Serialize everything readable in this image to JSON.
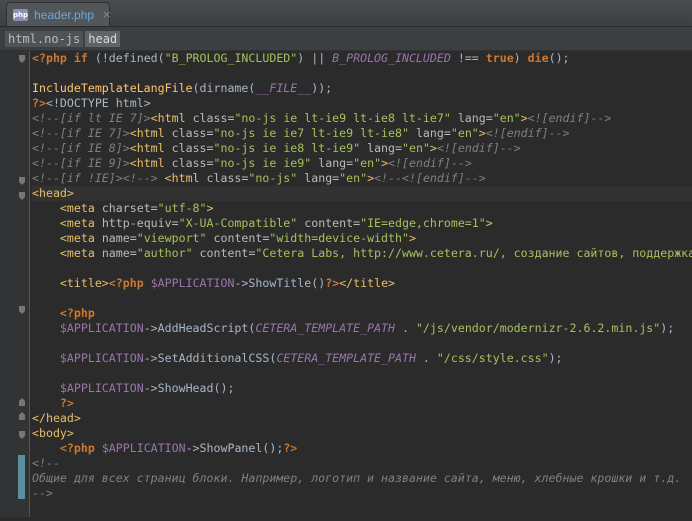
{
  "tab": {
    "icon": "php-icon",
    "label": "header.php",
    "close": "×"
  },
  "breadcrumb": [
    {
      "label": "html.no-js"
    },
    {
      "label": "head"
    }
  ],
  "lines": [
    {
      "t": [
        [
          "ph",
          "<?php "
        ],
        [
          "kw",
          "if"
        ],
        [
          "def",
          " (!defined("
        ],
        [
          "str",
          "\"B_PROLOG_INCLUDED\""
        ],
        [
          "def",
          ") || "
        ],
        [
          "cst",
          "B_PROLOG_INCLUDED"
        ],
        [
          "def",
          " !== "
        ],
        [
          "kw",
          "true"
        ],
        [
          "def",
          ") "
        ],
        [
          "kw",
          "die"
        ],
        [
          "def",
          "();"
        ]
      ]
    },
    {
      "t": []
    },
    {
      "t": [
        [
          "fn",
          "IncludeTemplateLangFile"
        ],
        [
          "def",
          "(dirname("
        ],
        [
          "cst",
          "__FILE__"
        ],
        [
          "def",
          "));"
        ]
      ]
    },
    {
      "t": [
        [
          "ph",
          "?>"
        ],
        [
          "def",
          "<!DOCTYPE html>"
        ]
      ]
    },
    {
      "t": [
        [
          "cmt",
          "<!--[if lt IE 7]>"
        ],
        [
          "tagn",
          "<html "
        ],
        [
          "attr",
          "class="
        ],
        [
          "str",
          "\"no-js ie lt-ie9 lt-ie8 lt-ie7\""
        ],
        [
          "attr",
          " lang="
        ],
        [
          "str",
          "\"en\""
        ],
        [
          "tagn",
          ">"
        ],
        [
          "cmt",
          "<![endif]-->"
        ]
      ]
    },
    {
      "t": [
        [
          "cmt",
          "<!--[if IE 7]>"
        ],
        [
          "tagn",
          "<html "
        ],
        [
          "attr",
          "class="
        ],
        [
          "str",
          "\"no-js ie ie7 lt-ie9 lt-ie8\""
        ],
        [
          "attr",
          " lang="
        ],
        [
          "str",
          "\"en\""
        ],
        [
          "tagn",
          ">"
        ],
        [
          "cmt",
          "<![endif]-->"
        ]
      ]
    },
    {
      "t": [
        [
          "cmt",
          "<!--[if IE 8]>"
        ],
        [
          "tagn",
          "<html "
        ],
        [
          "attr",
          "class="
        ],
        [
          "str",
          "\"no-js ie ie8 lt-ie9\""
        ],
        [
          "attr",
          " lang="
        ],
        [
          "str",
          "\"en\""
        ],
        [
          "tagn",
          ">"
        ],
        [
          "cmt",
          "<![endif]-->"
        ]
      ]
    },
    {
      "t": [
        [
          "cmt",
          "<!--[if IE 9]>"
        ],
        [
          "tagn",
          "<html "
        ],
        [
          "attr",
          "class="
        ],
        [
          "str",
          "\"no-js ie ie9\""
        ],
        [
          "attr",
          " lang="
        ],
        [
          "str",
          "\"en\""
        ],
        [
          "tagn",
          ">"
        ],
        [
          "cmt",
          "<![endif]-->"
        ]
      ]
    },
    {
      "t": [
        [
          "cmt",
          "<!--[if !IE]><!--> "
        ],
        [
          "tagn",
          "<html "
        ],
        [
          "attr",
          "class="
        ],
        [
          "str",
          "\"no-js\""
        ],
        [
          "attr",
          " lang="
        ],
        [
          "str",
          "\"en\""
        ],
        [
          "tagn",
          ">"
        ],
        [
          "cmt",
          "<!--<![endif]-->"
        ]
      ]
    },
    {
      "t": [
        [
          "tagn",
          "<head>"
        ]
      ],
      "hl": true
    },
    {
      "t": [
        [
          "def",
          "    "
        ],
        [
          "tagn",
          "<meta "
        ],
        [
          "attr",
          "charset="
        ],
        [
          "str",
          "\"utf-8\""
        ],
        [
          "tagn",
          ">"
        ]
      ]
    },
    {
      "t": [
        [
          "def",
          "    "
        ],
        [
          "tagn",
          "<meta "
        ],
        [
          "attr",
          "http-equiv="
        ],
        [
          "str",
          "\"X-UA-Compatible\""
        ],
        [
          "attr",
          " content="
        ],
        [
          "str",
          "\"IE=edge,chrome=1\""
        ],
        [
          "tagn",
          ">"
        ]
      ]
    },
    {
      "t": [
        [
          "def",
          "    "
        ],
        [
          "tagn",
          "<meta "
        ],
        [
          "attr",
          "name="
        ],
        [
          "str",
          "\"viewport\""
        ],
        [
          "attr",
          " content="
        ],
        [
          "str",
          "\"width=device-width\""
        ],
        [
          "tagn",
          ">"
        ]
      ]
    },
    {
      "t": [
        [
          "def",
          "    "
        ],
        [
          "tagn",
          "<meta "
        ],
        [
          "attr",
          "name="
        ],
        [
          "str",
          "\"author\""
        ],
        [
          "attr",
          " content="
        ],
        [
          "str",
          "\"Cetera Labs, http://www.cetera.ru/, создание сайтов, поддержка"
        ]
      ]
    },
    {
      "t": []
    },
    {
      "t": [
        [
          "def",
          "    "
        ],
        [
          "tagn",
          "<title>"
        ],
        [
          "ph",
          "<?php "
        ],
        [
          "var",
          "$APPLICATION"
        ],
        [
          "def",
          "->"
        ],
        [
          "def",
          "ShowTitle"
        ],
        [
          "def",
          "()"
        ],
        [
          "ph",
          "?>"
        ],
        [
          "tagn",
          "</title>"
        ]
      ]
    },
    {
      "t": []
    },
    {
      "t": [
        [
          "def",
          "    "
        ],
        [
          "ph",
          "<?php"
        ]
      ]
    },
    {
      "t": [
        [
          "def",
          "    "
        ],
        [
          "var",
          "$APPLICATION"
        ],
        [
          "def",
          "->"
        ],
        [
          "def",
          "AddHeadScript("
        ],
        [
          "cst",
          "CETERA_TEMPLATE_PATH"
        ],
        [
          "def",
          " . "
        ],
        [
          "str",
          "\"/js/vendor/modernizr-2.6.2.min.js\""
        ],
        [
          "def",
          ");"
        ]
      ]
    },
    {
      "t": []
    },
    {
      "t": [
        [
          "def",
          "    "
        ],
        [
          "var",
          "$APPLICATION"
        ],
        [
          "def",
          "->"
        ],
        [
          "def",
          "SetAdditionalCSS("
        ],
        [
          "cst",
          "CETERA_TEMPLATE_PATH"
        ],
        [
          "def",
          " . "
        ],
        [
          "str",
          "\"/css/style.css\""
        ],
        [
          "def",
          ");"
        ]
      ]
    },
    {
      "t": []
    },
    {
      "t": [
        [
          "def",
          "    "
        ],
        [
          "var",
          "$APPLICATION"
        ],
        [
          "def",
          "->"
        ],
        [
          "def",
          "ShowHead();"
        ]
      ]
    },
    {
      "t": [
        [
          "def",
          "    "
        ],
        [
          "ph",
          "?>"
        ]
      ]
    },
    {
      "t": [
        [
          "tagn",
          "</head>"
        ]
      ]
    },
    {
      "t": [
        [
          "tagn",
          "<body>"
        ]
      ]
    },
    {
      "t": [
        [
          "def",
          "    "
        ],
        [
          "ph",
          "<?php "
        ],
        [
          "var",
          "$APPLICATION"
        ],
        [
          "def",
          "->"
        ],
        [
          "def",
          "ShowPanel();"
        ],
        [
          "ph",
          "?>"
        ]
      ]
    },
    {
      "t": [
        [
          "cmt",
          "<!--"
        ]
      ]
    },
    {
      "t": [
        [
          "cmt",
          "Общие для всех страниц блоки. Например, логотип и название сайта, меню, хлебные крошки и т.д."
        ]
      ]
    },
    {
      "t": [
        [
          "cmt",
          "-->"
        ]
      ]
    }
  ]
}
